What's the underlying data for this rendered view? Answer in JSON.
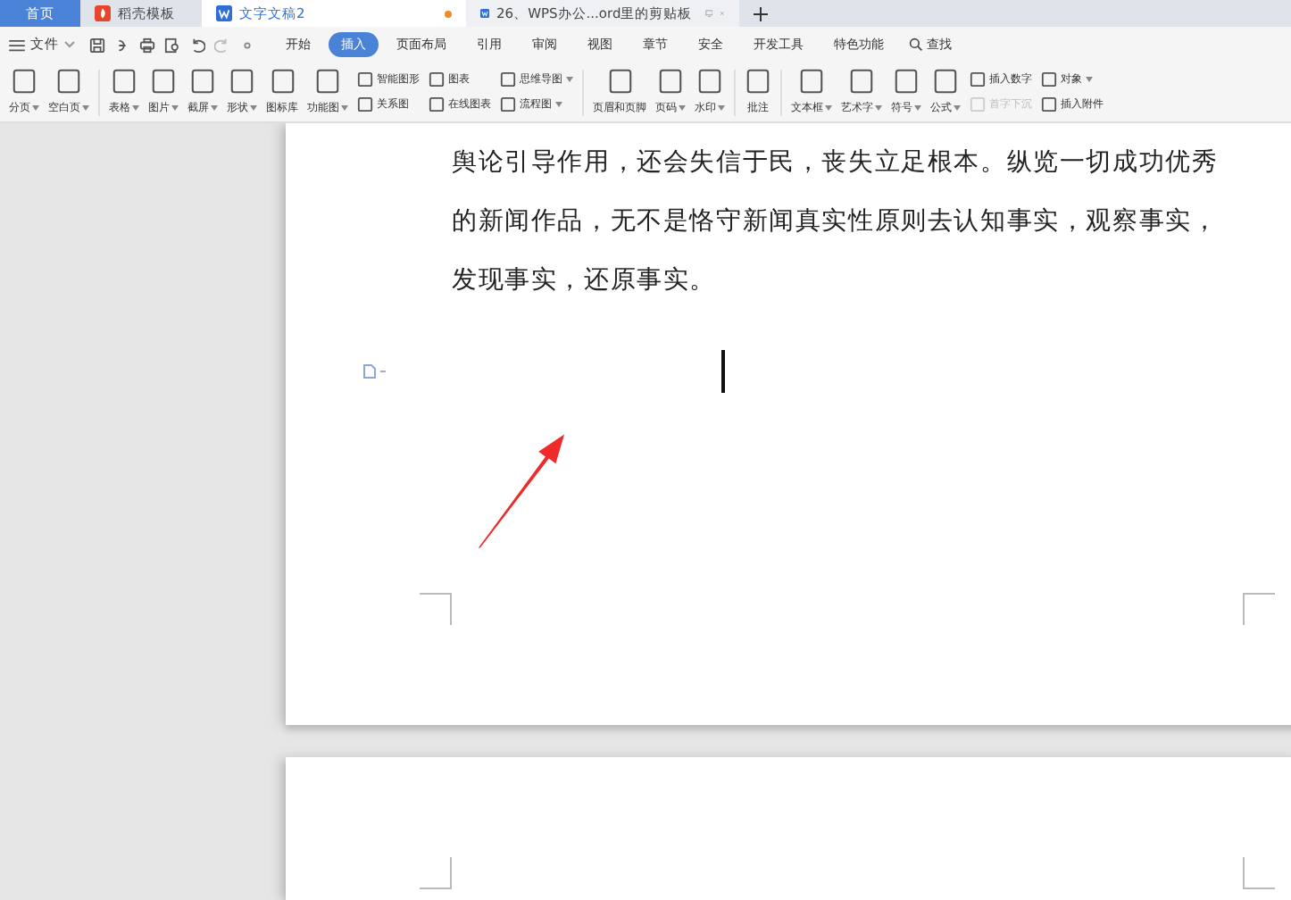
{
  "tabs": [
    {
      "label": "首页",
      "kind": "home",
      "selected": false
    },
    {
      "label": "稻壳模板",
      "kind": "template",
      "selected": false
    },
    {
      "label": "文字文稿2",
      "kind": "document",
      "selected": true,
      "unsaved": true
    },
    {
      "label": "26、WPS办公...ord里的剪贴板",
      "kind": "document",
      "selected": false,
      "unsaved": false
    }
  ],
  "menu": {
    "file_label": "文件",
    "tabs": [
      {
        "label": "开始",
        "selected": false
      },
      {
        "label": "插入",
        "selected": true
      },
      {
        "label": "页面布局",
        "selected": false
      },
      {
        "label": "引用",
        "selected": false
      },
      {
        "label": "审阅",
        "selected": false
      },
      {
        "label": "视图",
        "selected": false
      },
      {
        "label": "章节",
        "selected": false
      },
      {
        "label": "安全",
        "selected": false
      },
      {
        "label": "开发工具",
        "selected": false
      },
      {
        "label": "特色功能",
        "selected": false
      }
    ],
    "search_label": "查找"
  },
  "ribbon": [
    {
      "kind": "big",
      "label": "分页",
      "dropdown": true
    },
    {
      "kind": "big",
      "label": "空白页",
      "dropdown": true
    },
    {
      "kind": "separator"
    },
    {
      "kind": "big",
      "label": "表格",
      "dropdown": true
    },
    {
      "kind": "big",
      "label": "图片",
      "dropdown": true
    },
    {
      "kind": "big",
      "label": "截屏",
      "dropdown": true
    },
    {
      "kind": "big",
      "label": "形状",
      "dropdown": true
    },
    {
      "kind": "big",
      "label": "图标库",
      "dropdown": false
    },
    {
      "kind": "big",
      "label": "功能图",
      "dropdown": true
    },
    {
      "kind": "small",
      "items": [
        {
          "label": "智能图形",
          "dropdown": false,
          "disabled": false
        },
        {
          "label": "关系图",
          "dropdown": false,
          "disabled": false
        }
      ]
    },
    {
      "kind": "small",
      "items": [
        {
          "label": "图表",
          "dropdown": false,
          "disabled": false
        },
        {
          "label": "在线图表",
          "dropdown": false,
          "disabled": false
        }
      ]
    },
    {
      "kind": "small",
      "items": [
        {
          "label": "思维导图",
          "dropdown": true,
          "disabled": false
        },
        {
          "label": "流程图",
          "dropdown": true,
          "disabled": false
        }
      ]
    },
    {
      "kind": "separator"
    },
    {
      "kind": "big",
      "label": "页眉和页脚",
      "dropdown": false
    },
    {
      "kind": "big",
      "label": "页码",
      "dropdown": true
    },
    {
      "kind": "big",
      "label": "水印",
      "dropdown": true
    },
    {
      "kind": "separator"
    },
    {
      "kind": "big",
      "label": "批注",
      "dropdown": false
    },
    {
      "kind": "separator"
    },
    {
      "kind": "big",
      "label": "文本框",
      "dropdown": true
    },
    {
      "kind": "big",
      "label": "艺术字",
      "dropdown": true
    },
    {
      "kind": "big",
      "label": "符号",
      "dropdown": true
    },
    {
      "kind": "big",
      "label": "公式",
      "dropdown": true
    },
    {
      "kind": "small",
      "items": [
        {
          "label": "插入数字",
          "dropdown": false,
          "disabled": false
        },
        {
          "label": "首字下沉",
          "dropdown": false,
          "disabled": true
        }
      ]
    },
    {
      "kind": "small",
      "items": [
        {
          "label": "对象",
          "dropdown": true,
          "disabled": false
        },
        {
          "label": "插入附件",
          "dropdown": false,
          "disabled": false
        }
      ]
    }
  ],
  "document": {
    "paragraph": "舆论引导作用，还会失信于民，丧失立足根本。纵览一切成功优秀的新闻作品，无不是恪守新闻真实性原则去认知事实，观察事实，发现事实，还原事实。"
  }
}
